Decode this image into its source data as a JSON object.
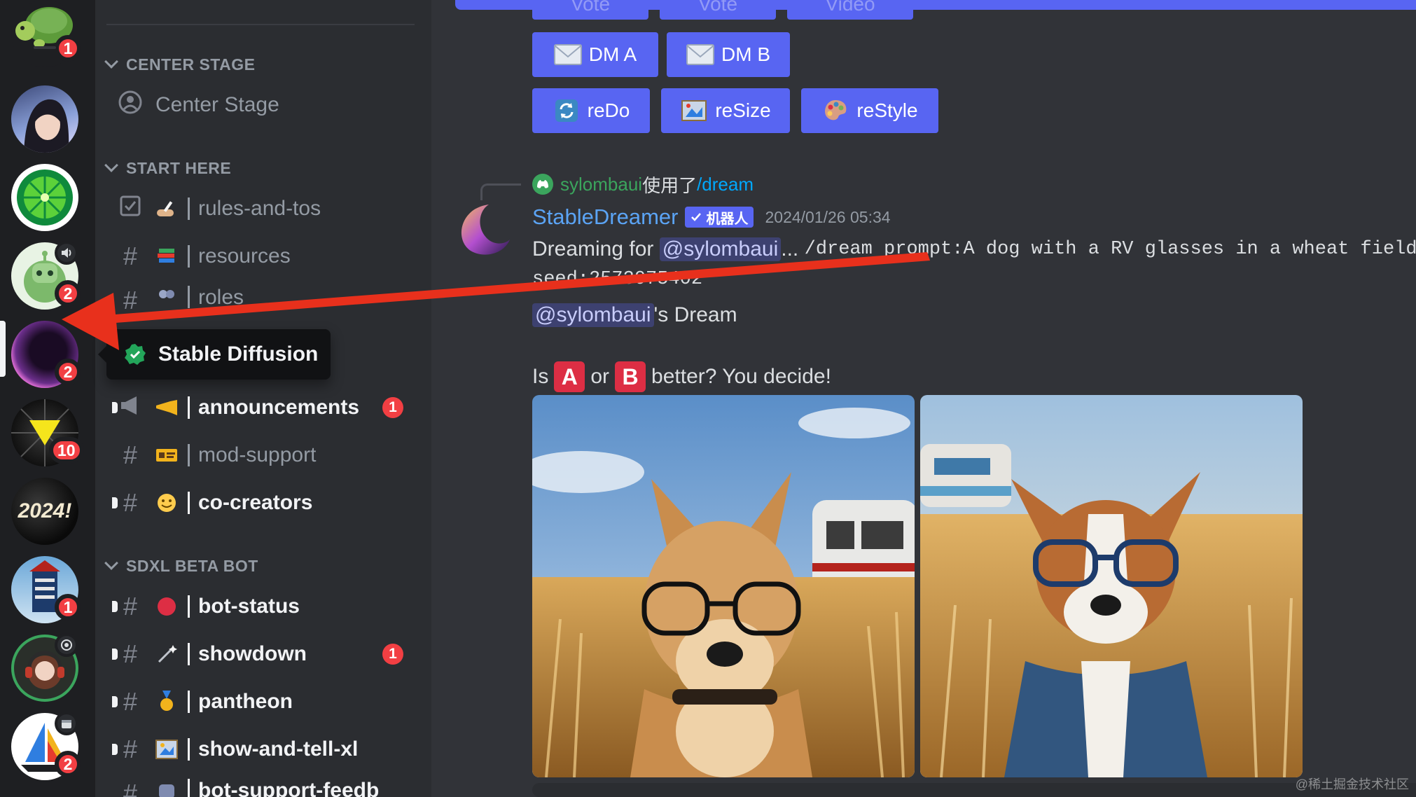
{
  "servers": [
    {
      "name": "turtle-server",
      "badge": "1"
    },
    {
      "name": "anime-server",
      "badge": ""
    },
    {
      "name": "lime-server",
      "badge": ""
    },
    {
      "name": "robot-server",
      "badge": "2"
    },
    {
      "name": "stable-diffusion-server",
      "badge": "2"
    },
    {
      "name": "yellow-triangle-server",
      "badge": "10"
    },
    {
      "name": "new-year-server",
      "badge": ""
    },
    {
      "name": "keep-calm-server",
      "badge": "1"
    },
    {
      "name": "headphones-server",
      "badge": ""
    },
    {
      "name": "sailboat-server",
      "badge": "2"
    }
  ],
  "server_tooltip": "Stable Diffusion",
  "banner_text_2024": "2024!",
  "categories": {
    "center_stage": "CENTER STAGE",
    "start_here": "START HERE",
    "sdxl_beta_bot": "SDXL BETA BOT"
  },
  "channels": {
    "center_stage": {
      "label": "Center Stage"
    },
    "rules": {
      "label": "rules-and-tos"
    },
    "resources": {
      "label": "resources"
    },
    "roles": {
      "label": "roles"
    },
    "announcements": {
      "label": "announcements",
      "count": "1"
    },
    "mod_support": {
      "label": "mod-support"
    },
    "co_creators": {
      "label": "co-creators"
    },
    "bot_status": {
      "label": "bot-status"
    },
    "showdown": {
      "label": "showdown",
      "count": "1"
    },
    "pantheon": {
      "label": "pantheon"
    },
    "show_and_tell": {
      "label": "show-and-tell-xl"
    },
    "bot_support": {
      "label": "bot-support-feedb"
    }
  },
  "buttons": {
    "top_partial": [
      "Vote",
      "Vote",
      "Video"
    ],
    "dm_a": "DM A",
    "dm_b": "DM B",
    "redo": "reDo",
    "resize": "reSize",
    "restyle": "reStyle"
  },
  "message": {
    "reply_user": "sylombaui",
    "reply_used": "使用了",
    "reply_command": "/dream",
    "author": "StableDreamer",
    "bot_tag": "机器人",
    "timestamp": "2024/01/26 05:34",
    "dreaming_for": "Dreaming for",
    "mention": "@sylombaui",
    "ellipsis": "...",
    "prompt": "/dream prompt:A dog with a RV glasses in a wheat field",
    "seed": "seed:2573075402",
    "dream_mention": "@sylombaui",
    "dream_suffix": "'s Dream",
    "decide_is": "Is",
    "label_a": "A",
    "decide_or": "or",
    "label_b": "B",
    "decide_rest": "better? You decide!"
  },
  "watermark": "@稀土掘金技术社区",
  "colors": {
    "blurple": "#5865f2",
    "annotation_arrow": "#e8301c",
    "unread_badge": "#f23f43"
  }
}
